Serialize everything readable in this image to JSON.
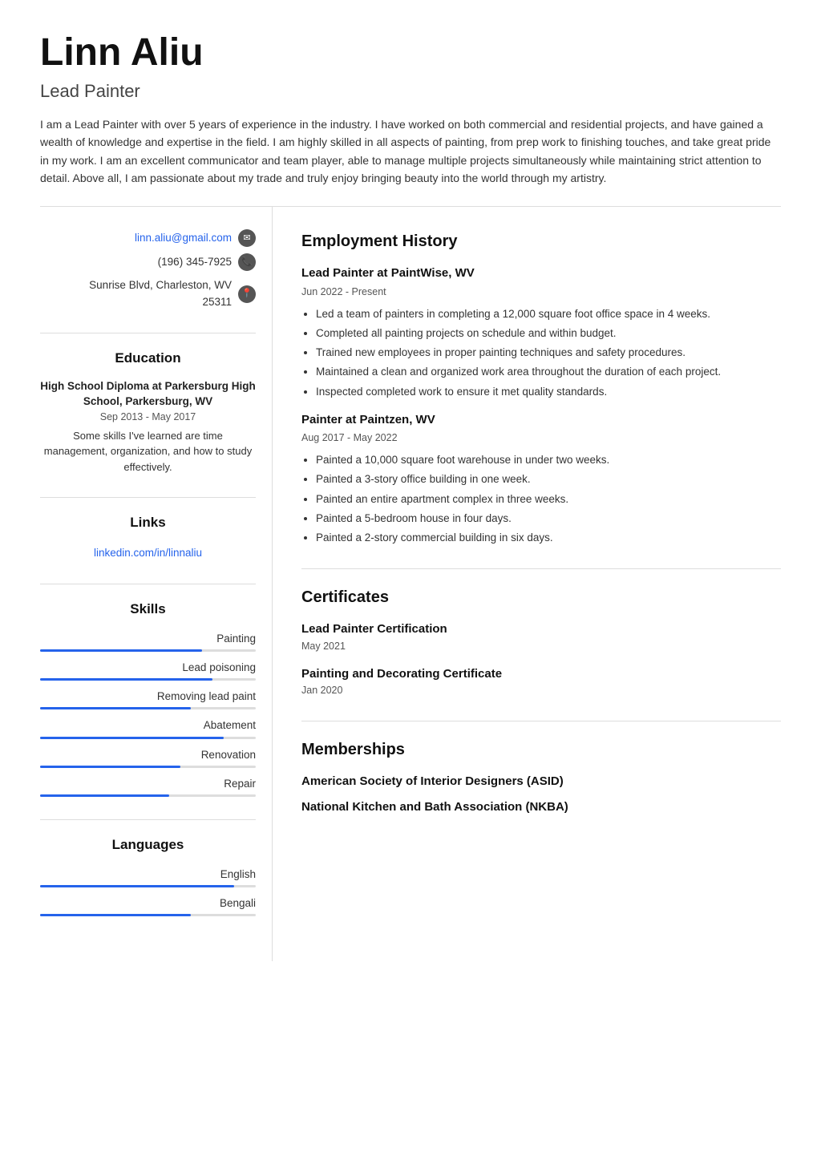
{
  "header": {
    "name": "Linn Aliu",
    "title": "Lead Painter",
    "summary": "I am a Lead Painter with over 5 years of experience in the industry. I have worked on both commercial and residential projects, and have gained a wealth of knowledge and expertise in the field. I am highly skilled in all aspects of painting, from prep work to finishing touches, and take great pride in my work. I am an excellent communicator and team player, able to manage multiple projects simultaneously while maintaining strict attention to detail. Above all, I am passionate about my trade and truly enjoy bringing beauty into the world through my artistry."
  },
  "contact": {
    "email": "linn.aliu@gmail.com",
    "phone": "(196) 345-7925",
    "address_line1": "Sunrise Blvd, Charleston, WV",
    "address_line2": "25311"
  },
  "education": {
    "heading": "Education",
    "school": "High School Diploma at Parkersburg High School, Parkersburg, WV",
    "dates": "Sep 2013 - May 2017",
    "description": "Some skills I've learned are time management, organization, and how to study effectively."
  },
  "links": {
    "heading": "Links",
    "linkedin_text": "linkedin.com/in/linnaliu",
    "linkedin_href": "#"
  },
  "skills": {
    "heading": "Skills",
    "items": [
      {
        "name": "Painting",
        "pct": 75
      },
      {
        "name": "Lead poisoning",
        "pct": 80
      },
      {
        "name": "Removing lead paint",
        "pct": 70
      },
      {
        "name": "Abatement",
        "pct": 85
      },
      {
        "name": "Renovation",
        "pct": 65
      },
      {
        "name": "Repair",
        "pct": 60
      }
    ]
  },
  "languages": {
    "heading": "Languages",
    "items": [
      {
        "name": "English",
        "pct": 90
      },
      {
        "name": "Bengali",
        "pct": 70
      }
    ]
  },
  "employment": {
    "heading": "Employment History",
    "jobs": [
      {
        "title": "Lead Painter at PaintWise, WV",
        "dates": "Jun 2022 - Present",
        "bullets": [
          "Led a team of painters in completing a 12,000 square foot office space in 4 weeks.",
          "Completed all painting projects on schedule and within budget.",
          "Trained new employees in proper painting techniques and safety procedures.",
          "Maintained a clean and organized work area throughout the duration of each project.",
          "Inspected completed work to ensure it met quality standards."
        ]
      },
      {
        "title": "Painter at Paintzen, WV",
        "dates": "Aug 2017 - May 2022",
        "bullets": [
          "Painted a 10,000 square foot warehouse in under two weeks.",
          "Painted a 3-story office building in one week.",
          "Painted an entire apartment complex in three weeks.",
          "Painted a 5-bedroom house in four days.",
          "Painted a 2-story commercial building in six days."
        ]
      }
    ]
  },
  "certificates": {
    "heading": "Certificates",
    "items": [
      {
        "name": "Lead Painter Certification",
        "date": "May 2021"
      },
      {
        "name": "Painting and Decorating Certificate",
        "date": "Jan 2020"
      }
    ]
  },
  "memberships": {
    "heading": "Memberships",
    "items": [
      "American Society of Interior Designers (ASID)",
      "National Kitchen and Bath Association (NKBA)"
    ]
  }
}
